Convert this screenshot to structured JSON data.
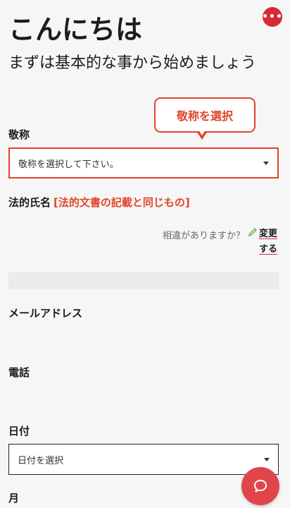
{
  "header": {
    "greeting": "こんにちは",
    "subtitle": "まずは基本的な事から始めましょう",
    "menu_icon": "more-dots-icon"
  },
  "callout": {
    "text": "敬称を選択"
  },
  "form": {
    "title_label": "敬称",
    "title_placeholder": "敬称を選択して下さい。",
    "legal_name_label": "法的氏名",
    "legal_name_note": "[法的文書の記載と同じもの]",
    "mismatch_text": "相違がありますか？",
    "change_link": "変更する",
    "email_label": "メールアドレス",
    "phone_label": "電話",
    "date_label": "日付",
    "date_placeholder": "日付を選択",
    "month_label": "月"
  },
  "colors": {
    "accent": "#e0452a",
    "brand_red": "#d62b33"
  },
  "chat_icon": "chat-bubble-icon"
}
